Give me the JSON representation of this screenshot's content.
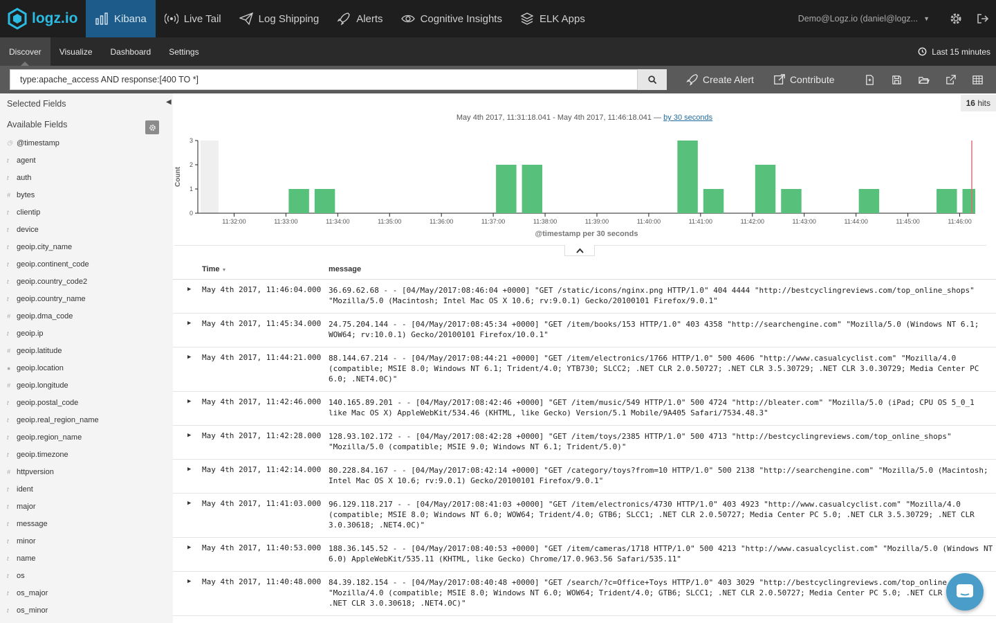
{
  "brand": {
    "name": "logz.io",
    "accent": "#2bbbe3"
  },
  "nav": [
    {
      "label": "Kibana",
      "icon": "bar-chart-icon",
      "active": true
    },
    {
      "label": "Live Tail",
      "icon": "broadcast-icon"
    },
    {
      "label": "Log Shipping",
      "icon": "paper-plane-icon"
    },
    {
      "label": "Alerts",
      "icon": "rocket-icon"
    },
    {
      "label": "Cognitive Insights",
      "icon": "eye-icon"
    },
    {
      "label": "ELK Apps",
      "icon": "layers-icon"
    }
  ],
  "user": {
    "label": "Demo@Logz.io (daniel@logz..."
  },
  "subnav": {
    "tabs": [
      {
        "label": "Discover",
        "active": true
      },
      {
        "label": "Visualize"
      },
      {
        "label": "Dashboard"
      },
      {
        "label": "Settings"
      }
    ],
    "timerange": "Last 15 minutes"
  },
  "query": {
    "value": "type:apache_access AND response:[400 TO *]",
    "create_alert": "Create Alert",
    "contribute": "Contribute"
  },
  "sidebar": {
    "selected_title": "Selected Fields",
    "available_title": "Available Fields",
    "fields": [
      {
        "name": "@timestamp",
        "type": "clock"
      },
      {
        "name": "agent",
        "type": "t"
      },
      {
        "name": "auth",
        "type": "t"
      },
      {
        "name": "bytes",
        "type": "#"
      },
      {
        "name": "clientip",
        "type": "t"
      },
      {
        "name": "device",
        "type": "t"
      },
      {
        "name": "geoip.city_name",
        "type": "t"
      },
      {
        "name": "geoip.continent_code",
        "type": "t"
      },
      {
        "name": "geoip.country_code2",
        "type": "t"
      },
      {
        "name": "geoip.country_name",
        "type": "t"
      },
      {
        "name": "geoip.dma_code",
        "type": "#"
      },
      {
        "name": "geoip.ip",
        "type": "t"
      },
      {
        "name": "geoip.latitude",
        "type": "#"
      },
      {
        "name": "geoip.location",
        "type": "globe"
      },
      {
        "name": "geoip.longitude",
        "type": "#"
      },
      {
        "name": "geoip.postal_code",
        "type": "t"
      },
      {
        "name": "geoip.real_region_name",
        "type": "t"
      },
      {
        "name": "geoip.region_name",
        "type": "t"
      },
      {
        "name": "geoip.timezone",
        "type": "t"
      },
      {
        "name": "httpversion",
        "type": "#"
      },
      {
        "name": "ident",
        "type": "t"
      },
      {
        "name": "major",
        "type": "t"
      },
      {
        "name": "message",
        "type": "t"
      },
      {
        "name": "minor",
        "type": "t"
      },
      {
        "name": "name",
        "type": "t"
      },
      {
        "name": "os",
        "type": "t"
      },
      {
        "name": "os_major",
        "type": "t"
      },
      {
        "name": "os_minor",
        "type": "t"
      }
    ]
  },
  "results": {
    "hits_count": "16",
    "hits_label": "hits",
    "range_text": "May 4th 2017, 11:31:18.041 - May 4th 2017, 11:46:18.041 —",
    "interval_link": "by 30 seconds",
    "col_time": "Time",
    "col_message": "message"
  },
  "chart_data": {
    "type": "bar",
    "ylabel": "Count",
    "xlabel": "@timestamp per 30 seconds",
    "ylim": [
      0,
      3
    ],
    "yticks": [
      0,
      1,
      2,
      3
    ],
    "xticks": [
      "11:32:00",
      "11:33:00",
      "11:34:00",
      "11:35:00",
      "11:36:00",
      "11:37:00",
      "11:38:00",
      "11:39:00",
      "11:40:00",
      "11:41:00",
      "11:42:00",
      "11:43:00",
      "11:44:00",
      "11:45:00",
      "11:46:00"
    ],
    "bar_color": "#57c17b",
    "bars": [
      {
        "t": "11:33:00",
        "value": 1
      },
      {
        "t": "11:33:30",
        "value": 1
      },
      {
        "t": "11:37:00",
        "value": 2
      },
      {
        "t": "11:37:30",
        "value": 2
      },
      {
        "t": "11:40:30",
        "value": 3
      },
      {
        "t": "11:41:00",
        "value": 1
      },
      {
        "t": "11:42:00",
        "value": 2
      },
      {
        "t": "11:42:30",
        "value": 1
      },
      {
        "t": "11:44:00",
        "value": 1
      },
      {
        "t": "11:45:30",
        "value": 1
      },
      {
        "t": "11:46:00",
        "value": 1
      }
    ]
  },
  "rows": [
    {
      "time": "May 4th 2017, 11:46:04.000",
      "lines": [
        "36.69.62.68 - - [04/May/2017:08:46:04 +0000] \"GET /static/icons/nginx.png HTTP/1.0\" 404 4444 \"http://bestcyclingreviews.com/top_online_shops\"",
        "\"Mozilla/5.0 (Macintosh; Intel Mac OS X 10.6; rv:9.0.1) Gecko/20100101 Firefox/9.0.1\""
      ]
    },
    {
      "time": "May 4th 2017, 11:45:34.000",
      "lines": [
        "24.75.204.144 - - [04/May/2017:08:45:34 +0000] \"GET /item/books/153 HTTP/1.0\" 403 4358 \"http://searchengine.com\" \"Mozilla/5.0 (Windows NT 6.1;",
        "WOW64; rv:10.0.1) Gecko/20100101 Firefox/10.0.1\""
      ]
    },
    {
      "time": "May 4th 2017, 11:44:21.000",
      "lines": [
        "88.144.67.214 - - [04/May/2017:08:44:21 +0000] \"GET /item/electronics/1766 HTTP/1.0\" 500 4606 \"http://www.casualcyclist.com\" \"Mozilla/4.0",
        "(compatible; MSIE 8.0; Windows NT 6.1; Trident/4.0; YTB730; SLCC2; .NET CLR 2.0.50727; .NET CLR 3.5.30729; .NET CLR 3.0.30729; Media Center PC",
        "6.0; .NET4.0C)\""
      ]
    },
    {
      "time": "May 4th 2017, 11:42:46.000",
      "lines": [
        "140.165.89.201 - - [04/May/2017:08:42:46 +0000] \"GET /item/music/549 HTTP/1.0\" 500 4724 \"http://bleater.com\" \"Mozilla/5.0 (iPad; CPU OS 5_0_1",
        "like Mac OS X) AppleWebKit/534.46 (KHTML, like Gecko) Version/5.1 Mobile/9A405 Safari/7534.48.3\""
      ]
    },
    {
      "time": "May 4th 2017, 11:42:28.000",
      "lines": [
        "128.93.102.172 - - [04/May/2017:08:42:28 +0000] \"GET /item/toys/2385 HTTP/1.0\" 500 4713 \"http://bestcyclingreviews.com/top_online_shops\"",
        "\"Mozilla/5.0 (compatible; MSIE 9.0; Windows NT 6.1; Trident/5.0)\""
      ]
    },
    {
      "time": "May 4th 2017, 11:42:14.000",
      "lines": [
        "80.228.84.167 - - [04/May/2017:08:42:14 +0000] \"GET /category/toys?from=10 HTTP/1.0\" 500 2138 \"http://searchengine.com\" \"Mozilla/5.0 (Macintosh;",
        "Intel Mac OS X 10.6; rv:9.0.1) Gecko/20100101 Firefox/9.0.1\""
      ]
    },
    {
      "time": "May 4th 2017, 11:41:03.000",
      "lines": [
        "96.129.118.217 - - [04/May/2017:08:41:03 +0000] \"GET /item/electronics/4730 HTTP/1.0\" 403 4923 \"http://www.casualcyclist.com\" \"Mozilla/4.0",
        "(compatible; MSIE 8.0; Windows NT 6.0; WOW64; Trident/4.0; GTB6; SLCC1; .NET CLR 2.0.50727; Media Center PC 5.0; .NET CLR 3.5.30729; .NET CLR",
        "3.0.30618; .NET4.0C)\""
      ]
    },
    {
      "time": "May 4th 2017, 11:40:53.000",
      "lines": [
        "188.36.145.52 - - [04/May/2017:08:40:53 +0000] \"GET /item/cameras/1718 HTTP/1.0\" 500 4213 \"http://www.casualcyclist.com\" \"Mozilla/5.0 (Windows NT",
        "6.0) AppleWebKit/535.11 (KHTML, like Gecko) Chrome/17.0.963.56 Safari/535.11\""
      ]
    },
    {
      "time": "May 4th 2017, 11:40:48.000",
      "lines": [
        "84.39.182.154 - - [04/May/2017:08:40:48 +0000] \"GET /search/?c=Office+Toys HTTP/1.0\" 403 3029 \"http://bestcyclingreviews.com/top_online_sho",
        "\"Mozilla/4.0 (compatible; MSIE 8.0; Windows NT 6.0; WOW64; Trident/4.0; GTB6; SLCC1; .NET CLR 2.0.50727; Media Center PC 5.0; .NET CLR 3.5",
        ".NET CLR 3.0.30618; .NET4.0C)\""
      ]
    }
  ]
}
